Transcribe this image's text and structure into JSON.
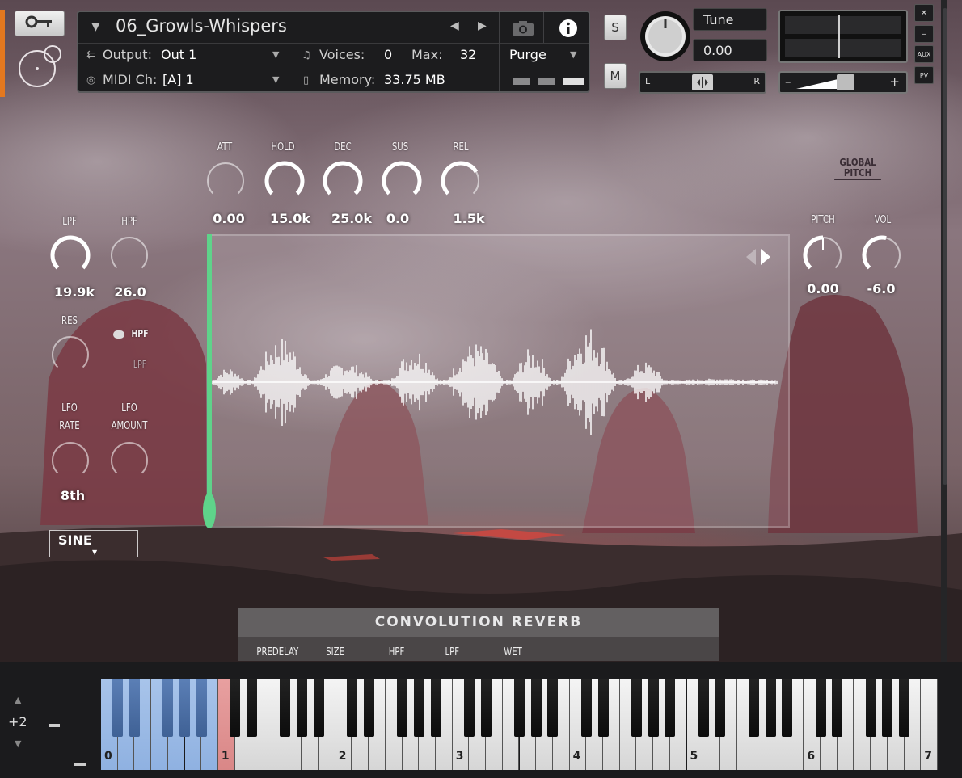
{
  "header": {
    "instrument_name": "06_Growls-Whispers",
    "output_label": "Output:",
    "output_value": "Out 1",
    "midi_label": "MIDI Ch:",
    "midi_value": "[A]  1",
    "voices_label": "Voices:",
    "voices_value": "0",
    "max_label": "Max:",
    "max_value": "32",
    "memory_label": "Memory:",
    "memory_value": "33.75 MB",
    "purge_label": "Purge",
    "solo_label": "S",
    "mute_label": "M",
    "tune_label": "Tune",
    "tune_value": "0.00",
    "pan_left": "L",
    "pan_right": "R",
    "vol_minus": "–",
    "vol_plus": "+",
    "side_buttons": [
      "✕",
      "–",
      "AUX",
      "PV"
    ]
  },
  "envelope": {
    "labels": [
      "ATT",
      "HOLD",
      "DEC",
      "SUS",
      "REL"
    ],
    "values": [
      "0.00",
      "15.0k",
      "25.0k",
      "0.0",
      "1.5k"
    ]
  },
  "filter": {
    "lpf_label": "LPF",
    "lpf_value": "19.9k",
    "hpf_label": "HPF",
    "hpf_value": "26.0",
    "res_label": "RES",
    "toggle_hpf": "HPF",
    "toggle_lpf": "LPF"
  },
  "lfo": {
    "rate_label_1": "LFO",
    "rate_label_2": "RATE",
    "rate_value": "8th",
    "amount_label_1": "LFO",
    "amount_label_2": "AMOUNT",
    "shape_value": "SINE"
  },
  "global": {
    "title_1": "GLOBAL",
    "title_2": "PITCH",
    "pitch_label": "PITCH",
    "pitch_value": "0.00",
    "vol_label": "VOL",
    "vol_value": "-6.0"
  },
  "reverb": {
    "title": "CONVOLUTION REVERB",
    "params": [
      "PREDELAY",
      "SIZE",
      "HPF",
      "LPF",
      "WET"
    ]
  },
  "keyboard": {
    "octave_shift": "+2",
    "octave_numbers": [
      "0",
      "1",
      "2",
      "3",
      "4",
      "5",
      "6",
      "7"
    ]
  },
  "colors": {
    "accent_orange": "#e3781f",
    "play_marker_green": "#5fd38a",
    "key_blue": "#9bbbe6",
    "key_red": "#d98787"
  }
}
